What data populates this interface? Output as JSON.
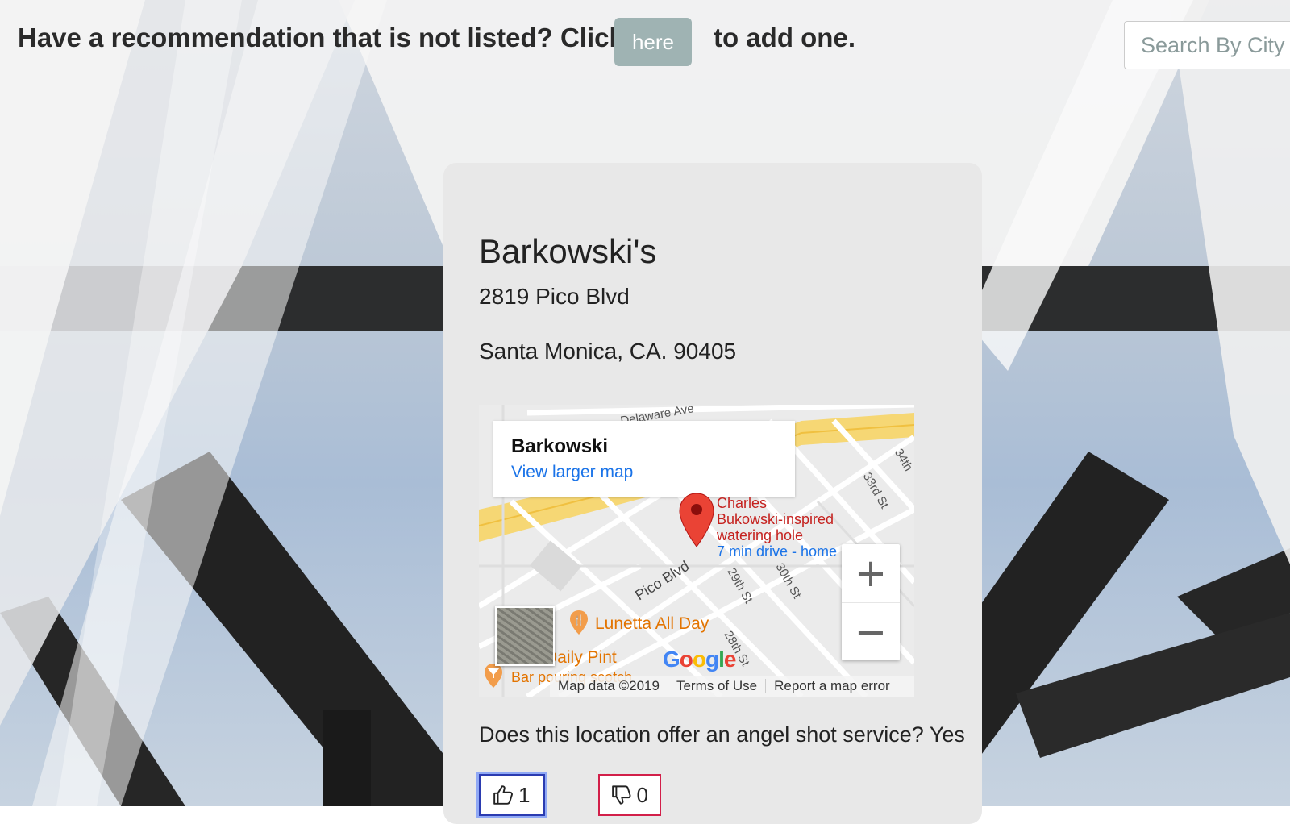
{
  "header": {
    "promo_before": "Have a recommendation that is not listed? Click",
    "here_label": "here",
    "promo_after": "to add one.",
    "search_placeholder": "Search By City"
  },
  "listing": {
    "name": "Barkowski's",
    "address_line1": "2819 Pico Blvd",
    "address_line2": "Santa Monica, CA. 90405",
    "question": "Does this location offer an angel shot service? Yes",
    "upvotes": "1",
    "downvotes": "0"
  },
  "map": {
    "info_name": "Barkowski",
    "view_larger": "View larger map",
    "place_description": [
      "Charles",
      "Bukowski-inspired",
      "watering hole"
    ],
    "drive_time": "7 min drive - home",
    "poi": [
      "Lunetta All Day",
      "The Daily Pint",
      "Bar pouring scotch"
    ],
    "streets": [
      "Delaware Ave",
      "Pico Blvd",
      "29th St",
      "30th St",
      "28th St",
      "33rd St",
      "34th"
    ],
    "footer": [
      "Map data ©2019",
      "Terms of Use",
      "Report a map error"
    ],
    "zoom_in": "+",
    "zoom_out": "−",
    "google": [
      "G",
      "o",
      "o",
      "g",
      "l",
      "e"
    ],
    "colors": {
      "marker": "#ea4335",
      "link": "#1a73e8",
      "highway": "#f6d774",
      "poi": "#e37400"
    }
  },
  "icons": {
    "thumbs_up": "thumbs-up-icon",
    "thumbs_down": "thumbs-down-icon"
  }
}
